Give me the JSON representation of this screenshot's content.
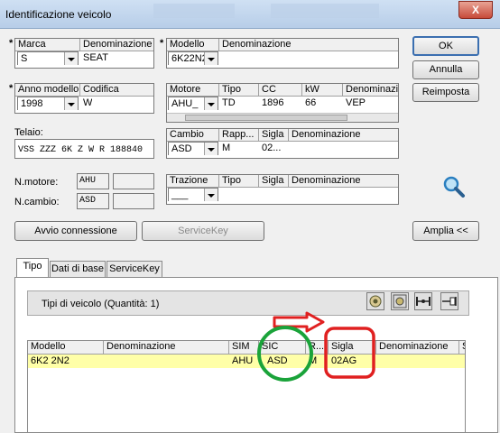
{
  "window": {
    "title": "Identificazione veicolo",
    "close_glyph": "X"
  },
  "buttons": {
    "ok": "OK",
    "annulla": "Annulla",
    "reimposta": "Reimposta",
    "avvio": "Avvio connessione",
    "servicekey": "ServiceKey",
    "amplia": "Amplia <<"
  },
  "marca": {
    "col1": "Marca",
    "col2": "Denominazione",
    "value": "S",
    "name": "SEAT"
  },
  "modello": {
    "col1": "Modello",
    "col2": "Denominazione",
    "value": "6K22N2",
    "name": ""
  },
  "anno": {
    "col1": "Anno modello",
    "col2": "Codifica",
    "value": "1998",
    "code": "W"
  },
  "motore": {
    "headers": [
      "Motore",
      "Tipo",
      "CC",
      "kW",
      "Denominazion"
    ],
    "values": [
      "AHU_",
      "TD",
      "1896",
      "66",
      "VEP"
    ]
  },
  "telaio": {
    "label": "Telaio:",
    "value": "VSS ZZZ 6K Z W R 188840"
  },
  "cambio": {
    "headers": [
      "Cambio",
      "Rapp...",
      "Sigla",
      "Denominazione"
    ],
    "values": [
      "ASD",
      "M",
      "02...",
      ""
    ]
  },
  "nmotore": {
    "label": "N.motore:",
    "value": "AHU"
  },
  "ncambio": {
    "label": "N.cambio:",
    "value": "ASD"
  },
  "trazione": {
    "headers": [
      "Trazione",
      "Tipo",
      "Sigla",
      "Denominazione"
    ],
    "values": [
      "___",
      "",
      "",
      ""
    ]
  },
  "tabs": [
    {
      "label": "Tipo"
    },
    {
      "label": "Dati di base"
    },
    {
      "label": "ServiceKey"
    }
  ],
  "tipi": {
    "label": "Tipi di veicolo (Quantità: 1)"
  },
  "table": {
    "headers": [
      "Modello",
      "Denominazione",
      "SIM",
      "SIC",
      "R...",
      "Sigla",
      "Denominazione",
      "S"
    ],
    "rows": [
      [
        "6K2 2N2",
        "",
        "AHU",
        "ASD",
        "M",
        "02AG",
        "",
        ""
      ]
    ]
  },
  "annotation_colors": {
    "arrow": "#e02020",
    "circle": "#1aa33a",
    "rect": "#e02020"
  }
}
